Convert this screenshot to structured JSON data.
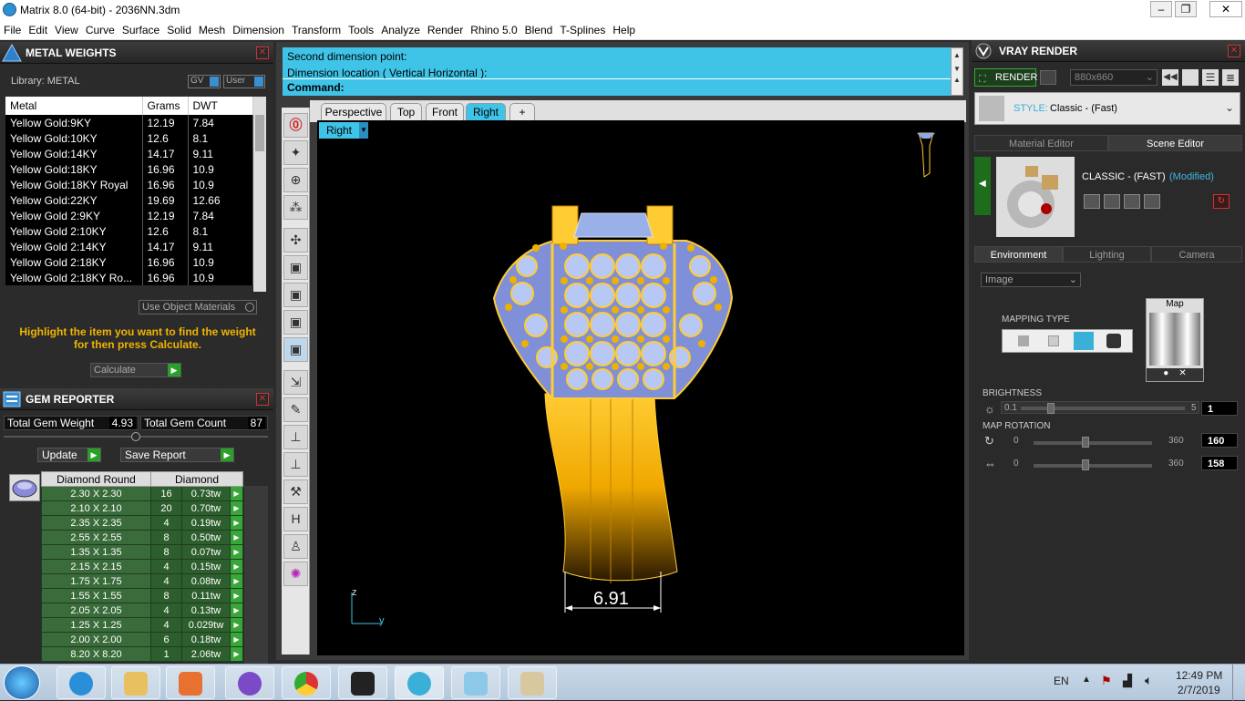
{
  "window": {
    "title": "Matrix 8.0 (64-bit) - 2036NN.3dm",
    "min": "–",
    "max": "❐",
    "close": "✕"
  },
  "menu": [
    "File",
    "Edit",
    "View",
    "Curve",
    "Surface",
    "Solid",
    "Mesh",
    "Dimension",
    "Transform",
    "Tools",
    "Analyze",
    "Render",
    "Rhino 5.0",
    "Blend",
    "T-Splines",
    "Help"
  ],
  "metal_weights": {
    "title": "METAL WEIGHTS",
    "library_label": "Library: METAL",
    "gv": "GV",
    "user": "User",
    "headers": [
      "Metal",
      "Grams",
      "DWT"
    ],
    "rows": [
      [
        "Yellow Gold:9KY",
        "12.19",
        "7.84"
      ],
      [
        "Yellow Gold:10KY",
        "12.6",
        "8.1"
      ],
      [
        "Yellow Gold:14KY",
        "14.17",
        "9.11"
      ],
      [
        "Yellow Gold:18KY",
        "16.96",
        "10.9"
      ],
      [
        "Yellow Gold:18KY Royal",
        "16.96",
        "10.9"
      ],
      [
        "Yellow Gold:22KY",
        "19.69",
        "12.66"
      ],
      [
        "Yellow Gold 2:9KY",
        "12.19",
        "7.84"
      ],
      [
        "Yellow Gold 2:10KY",
        "12.6",
        "8.1"
      ],
      [
        "Yellow Gold 2:14KY",
        "14.17",
        "9.11"
      ],
      [
        "Yellow Gold 2:18KY",
        "16.96",
        "10.9"
      ],
      [
        "Yellow Gold 2:18KY Ro...",
        "16.96",
        "10.9"
      ]
    ],
    "use_object_materials": "Use Object Materials",
    "hint": "Highlight the item you want to find the weight for then press Calculate.",
    "calculate": "Calculate"
  },
  "gem_reporter": {
    "title": "GEM REPORTER",
    "total_weight_label": "Total Gem Weight",
    "total_weight": "4.93",
    "total_count_label": "Total Gem Count",
    "total_count": "87",
    "update": "Update",
    "save_report": "Save Report",
    "col_shape": "Diamond Round",
    "col_material": "Diamond",
    "rows": [
      [
        "2.30 X 2.30",
        "16",
        "0.73tw"
      ],
      [
        "2.10 X 2.10",
        "20",
        "0.70tw"
      ],
      [
        "2.35 X 2.35",
        "4",
        "0.19tw"
      ],
      [
        "2.55 X 2.55",
        "8",
        "0.50tw"
      ],
      [
        "1.35 X 1.35",
        "8",
        "0.07tw"
      ],
      [
        "2.15 X 2.15",
        "4",
        "0.15tw"
      ],
      [
        "1.75 X 1.75",
        "4",
        "0.08tw"
      ],
      [
        "1.55 X 1.55",
        "8",
        "0.11tw"
      ],
      [
        "2.05 X 2.05",
        "4",
        "0.13tw"
      ],
      [
        "1.25 X 1.25",
        "4",
        "0.029tw"
      ],
      [
        "2.00 X 2.00",
        "6",
        "0.18tw"
      ],
      [
        "8.20 X 8.20",
        "1",
        "2.06tw"
      ]
    ]
  },
  "command": {
    "line1": "Second dimension point:",
    "line2": "Dimension location ( Vertical  Horizontal ):",
    "prompt": "Command:"
  },
  "viewport_tabs": [
    "Perspective",
    "Top",
    "Front",
    "Right",
    "+"
  ],
  "viewport": {
    "name": "Right",
    "dimension": "6.91",
    "axis_z": "z",
    "axis_y": "y"
  },
  "vray": {
    "title": "VRAY RENDER",
    "render": "RENDER",
    "resolution": "880x660",
    "style_label": "STYLE:",
    "style_value": "Classic - (Fast)",
    "tab_material": "Material Editor",
    "tab_scene": "Scene Editor",
    "preset_name": "CLASSIC - (FAST)",
    "preset_modified": "(Modified)",
    "tab_env": "Environment",
    "tab_light": "Lighting",
    "tab_camera": "Camera",
    "image_dropdown": "Image",
    "map_label": "Map",
    "mapping_type": "MAPPING TYPE",
    "brightness": "BRIGHTNESS",
    "b_min": "0.1",
    "b_max": "5",
    "b_val": "1",
    "map_rotation": "MAP ROTATION",
    "r1_min": "0",
    "r1_max": "360",
    "r1_val": "160",
    "r2_min": "0",
    "r2_max": "360",
    "r2_val": "158"
  },
  "taskbar": {
    "lang": "EN",
    "time": "12:49 PM",
    "date": "2/7/2019"
  },
  "colors": {
    "accent": "#3fc4e8",
    "gold": "#f0a800",
    "panel": "#2b2b2b"
  }
}
